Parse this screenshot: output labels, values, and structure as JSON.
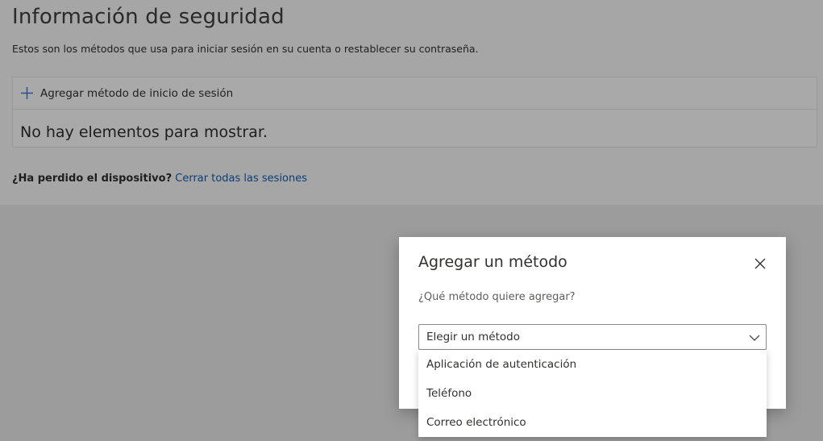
{
  "page": {
    "title": "Información de seguridad",
    "subtitle": "Estos son los métodos que usa para iniciar sesión en su cuenta o restablecer su contraseña.",
    "add_method_label": "Agregar método de inicio de sesión",
    "empty_message": "No hay elementos para mostrar.",
    "lost_device_question": "¿Ha perdido el dispositivo?",
    "sign_out_link": "Cerrar todas las sesiones"
  },
  "dialog": {
    "title": "Agregar un método",
    "question": "¿Qué método quiere agregar?",
    "select": {
      "value": "Elegir un método",
      "options": [
        "Aplicación de autenticación",
        "Teléfono",
        "Correo electrónico"
      ]
    }
  },
  "icons": {
    "add": "plus-icon",
    "close": "close-icon",
    "dropdown": "chevron-down-icon"
  },
  "colors": {
    "overlay_background": "#9c9c9c",
    "link": "#0c3d74",
    "accent_plus": "#274a8a",
    "dialog_background": "#ffffff"
  }
}
